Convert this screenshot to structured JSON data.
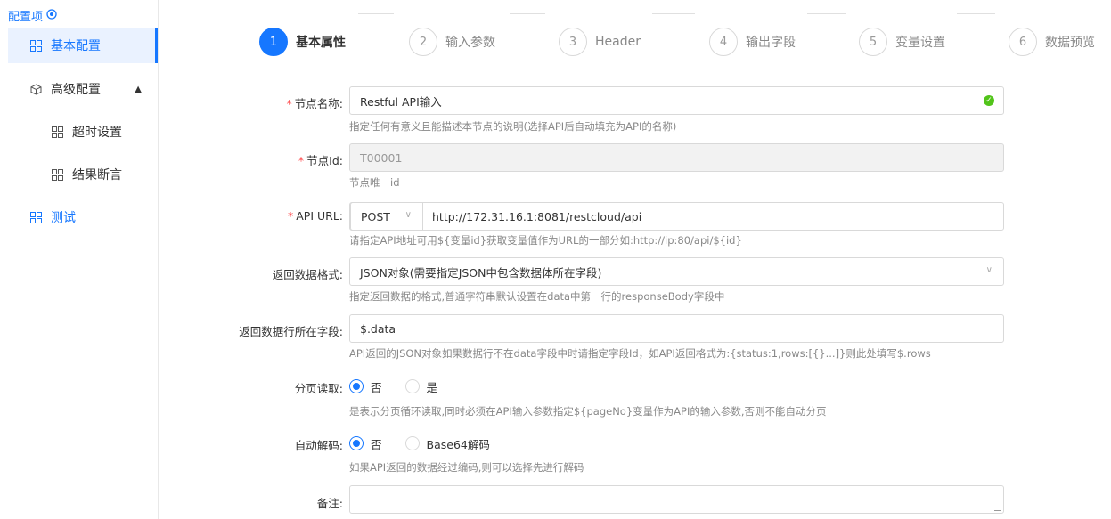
{
  "sidebar": {
    "title": "配置项",
    "items": [
      {
        "label": "基本配置"
      },
      {
        "label": "高级配置"
      },
      {
        "label": "超时设置"
      },
      {
        "label": "结果断言"
      },
      {
        "label": "测试"
      }
    ]
  },
  "steps": [
    {
      "num": "1",
      "label": "基本属性"
    },
    {
      "num": "2",
      "label": "输入参数"
    },
    {
      "num": "3",
      "label": "Header"
    },
    {
      "num": "4",
      "label": "输出字段"
    },
    {
      "num": "5",
      "label": "变量设置"
    },
    {
      "num": "6",
      "label": "数据预览"
    }
  ],
  "form": {
    "node_name": {
      "label": "节点名称:",
      "value": "Restful API输入",
      "help": "指定任何有意义且能描述本节点的说明(选择API后自动填充为API的名称)"
    },
    "node_id": {
      "label": "节点Id:",
      "value": "T00001",
      "help": "节点唯一id"
    },
    "api_url": {
      "label": "API URL:",
      "method": "POST",
      "value": "http://172.31.16.1:8081/restcloud/api",
      "help": "请指定API地址可用${变量id}获取变量值作为URL的一部分如:http://ip:80/api/${id}"
    },
    "return_format": {
      "label": "返回数据格式:",
      "value": "JSON对象(需要指定JSON中包含数据体所在字段)",
      "help": "指定返回数据的格式,普通字符串默认设置在data中第一行的responseBody字段中"
    },
    "data_field": {
      "label": "返回数据行所在字段:",
      "value": "$.data",
      "help": "API返回的JSON对象如果数据行不在data字段中时请指定字段Id，如API返回格式为:{status:1,rows:[{}...]}则此处填写$.rows"
    },
    "paging": {
      "label": "分页读取:",
      "options": [
        "否",
        "是"
      ],
      "help": "是表示分页循环读取,同时必须在API输入参数指定${pageNo}变量作为API的输入参数,否则不能自动分页"
    },
    "decode": {
      "label": "自动解码:",
      "options": [
        "否",
        "Base64解码"
      ],
      "help": "如果API返回的数据经过编码,则可以选择先进行解码"
    },
    "remark": {
      "label": "备注:"
    }
  }
}
